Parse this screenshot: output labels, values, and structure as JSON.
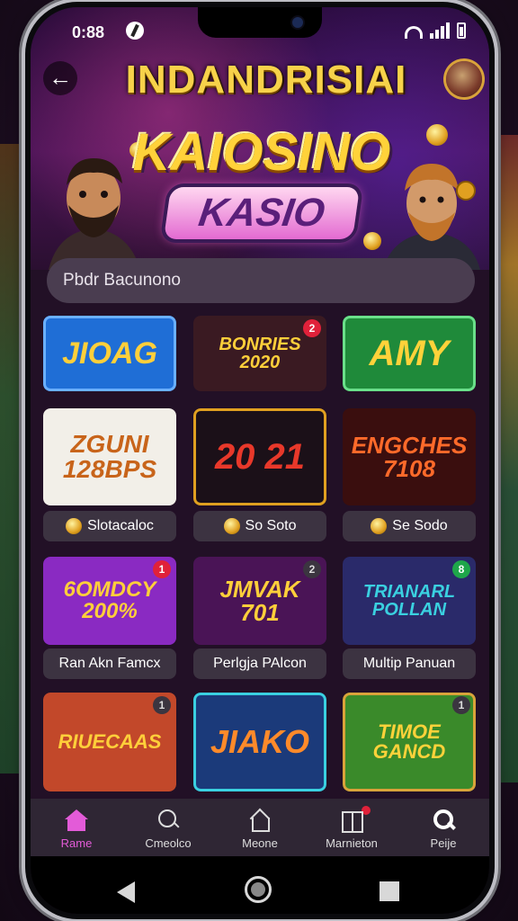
{
  "status_bar": {
    "time": "0:88"
  },
  "header": {
    "title": "INDANDRISIAI",
    "back_icon": "arrow-left-icon"
  },
  "hero": {
    "logo_line1": "KAIOSINO",
    "logo_line2": "KASIO"
  },
  "search": {
    "placeholder": "Pbdr Bacunono"
  },
  "tiles": [
    {
      "art_text": "JIOAG",
      "bg": "#1f6ed6",
      "fg": "#ffcf3a"
    },
    {
      "art_text": "BONRIES 2020",
      "bg": "#3a1a22",
      "fg": "#ffcf3a",
      "badge": "2"
    },
    {
      "art_text": "AMY",
      "bg": "#1f8a3a",
      "fg": "#ffd23a"
    },
    {
      "art_text": "ZGUNI 128BPS",
      "bg": "#f2efe8",
      "fg": "#c8641a",
      "label": "Slotacaloc"
    },
    {
      "art_text": "20 21",
      "bg": "#1b1018",
      "fg": "#e8382a",
      "label": "So Soto"
    },
    {
      "art_text": "ENGCHES 7108",
      "bg": "#3a0e0e",
      "fg": "#ff6a2a",
      "label": "Se Sodo"
    },
    {
      "art_text": "6OMDCY 200%",
      "bg": "#8a2ac2",
      "fg": "#ffcf3a",
      "label": "Ran Akn Famcx",
      "badge": "1"
    },
    {
      "art_text": "JMVAK 701",
      "bg": "#4a1456",
      "fg": "#ffcf3a",
      "label": "Perlgja PAlcon",
      "badge": "2"
    },
    {
      "art_text": "TRIANARL POLLAN",
      "bg": "#2a2a6a",
      "fg": "#3ad0e0",
      "label": "Multip Panuan",
      "badge": "8"
    },
    {
      "art_text": "RIUECAAS",
      "bg": "#c2482a",
      "fg": "#ffcf3a",
      "badge": "1"
    },
    {
      "art_text": "JIAKO",
      "bg": "#1b3a7a",
      "fg": "#ff8a2a"
    },
    {
      "art_text": "TIMOE GANCD",
      "bg": "#3a8a2a",
      "fg": "#ffd23a",
      "badge": "1"
    }
  ],
  "bottom_nav": [
    {
      "label": "Rame",
      "icon": "home-icon"
    },
    {
      "label": "Cmeolco",
      "icon": "search-icon"
    },
    {
      "label": "Meone",
      "icon": "house-outline-icon"
    },
    {
      "label": "Marnieton",
      "icon": "book-icon"
    },
    {
      "label": "Peije",
      "icon": "magnifier-icon"
    }
  ],
  "colors": {
    "accent": "#e35bd8",
    "gold": "#ffd23a",
    "card": "#3c3341"
  }
}
